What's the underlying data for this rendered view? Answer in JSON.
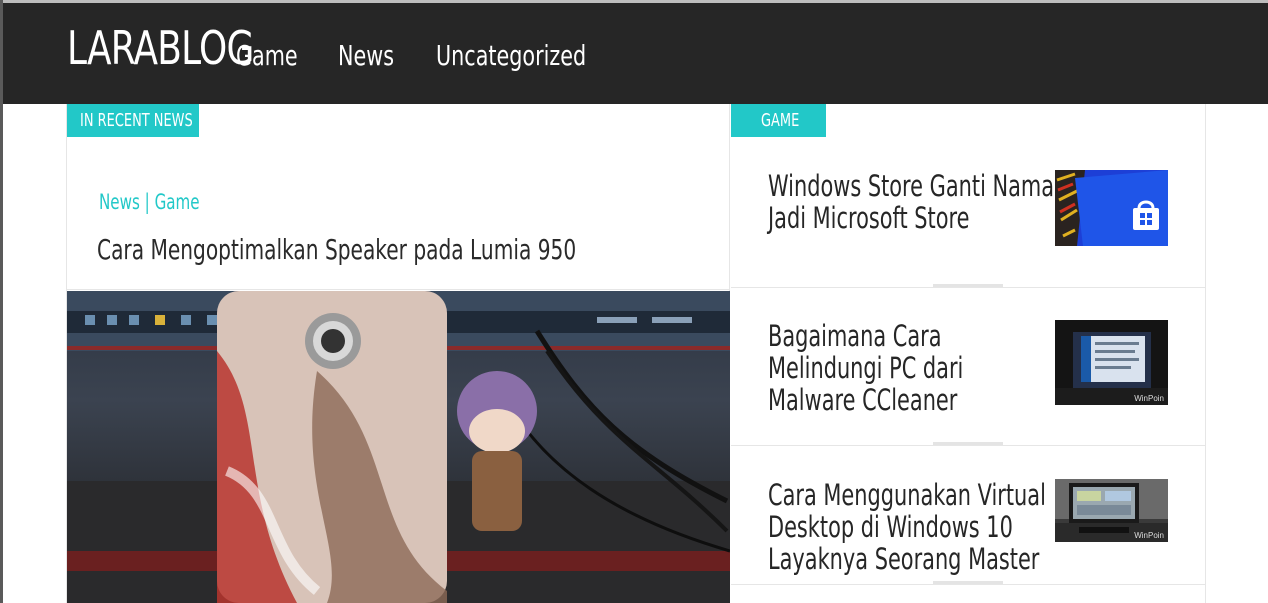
{
  "site": {
    "logo": "LARABLOG"
  },
  "nav": {
    "items": [
      {
        "label": "Game"
      },
      {
        "label": "News"
      },
      {
        "label": "Uncategorized"
      }
    ]
  },
  "featured": {
    "section_label": "IN RECENT NEWS",
    "categories": "News | Game",
    "title": "Cara Mengoptimalkan Speaker pada Lumia 950",
    "image_icon": "phone-on-desk-photo"
  },
  "sidebar": {
    "section_label": "GAME",
    "posts": [
      {
        "title": "Windows Store Ganti Nama Jadi Microsoft Store",
        "thumb_icon": "store-logo-thumbnail"
      },
      {
        "title": "Bagaimana Cara Melindungi PC dari Malware CCleaner",
        "thumb_icon": "laptop-screen-thumbnail",
        "watermark": "WinPoin"
      },
      {
        "title": "Cara Menggunakan Virtual Desktop di Windows 10 Layaknya Seorang Master",
        "thumb_icon": "desktop-monitor-thumbnail",
        "watermark": "WinPoin"
      }
    ]
  },
  "colors": {
    "accent": "#22c8c8",
    "header_bg": "#262626",
    "text": "#262626"
  }
}
